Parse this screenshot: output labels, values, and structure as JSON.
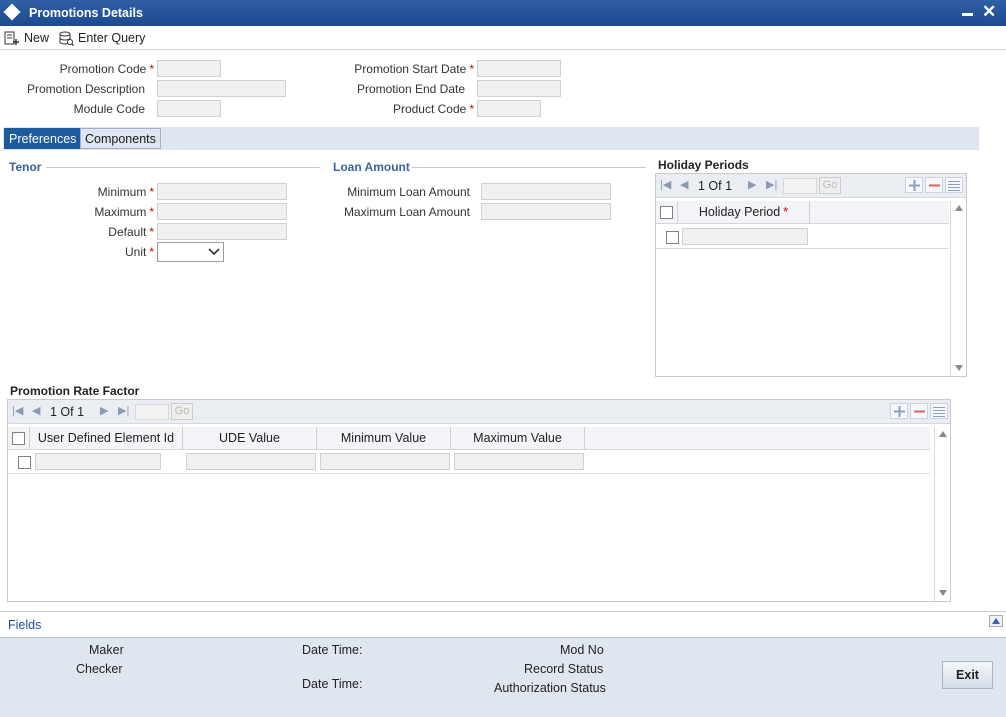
{
  "window": {
    "title": "Promotions Details"
  },
  "toolbar": {
    "new_label": "New",
    "enter_query_label": "Enter Query"
  },
  "header_fields": {
    "promotion_code": {
      "label": "Promotion Code",
      "value": ""
    },
    "promotion_description": {
      "label": "Promotion Description",
      "value": ""
    },
    "module_code": {
      "label": "Module Code",
      "value": ""
    },
    "promotion_start_date": {
      "label": "Promotion Start Date",
      "value": ""
    },
    "promotion_end_date": {
      "label": "Promotion End Date",
      "value": ""
    },
    "product_code": {
      "label": "Product Code",
      "value": ""
    }
  },
  "required_marker": "*",
  "tabs": [
    {
      "label": "Preferences",
      "active": true
    },
    {
      "label": "Components",
      "active": false
    }
  ],
  "tenor": {
    "heading": "Tenor",
    "minimum_label": "Minimum",
    "maximum_label": "Maximum",
    "default_label": "Default",
    "unit_label": "Unit",
    "unit_value": ""
  },
  "loan_amount": {
    "heading": "Loan Amount",
    "minimum_label": "Minimum Loan Amount",
    "maximum_label": "Maximum Loan Amount"
  },
  "holiday_periods": {
    "heading": "Holiday Periods",
    "page_text": "1 Of 1",
    "go_label": "Go",
    "columns": [
      "Holiday Period"
    ]
  },
  "promotion_rate_factor": {
    "heading": "Promotion Rate Factor",
    "page_text": "1 Of 1",
    "go_label": "Go",
    "columns": [
      "User Defined Element Id",
      "UDE Value",
      "Minimum Value",
      "Maximum Value"
    ]
  },
  "fields_link": "Fields",
  "footer": {
    "maker": "Maker",
    "checker": "Checker",
    "date_time_1": "Date Time:",
    "date_time_2": "Date Time:",
    "mod_no": "Mod No",
    "record_status": "Record Status",
    "authorization_status": "Authorization Status",
    "exit_label": "Exit"
  },
  "colors": {
    "title_bar": "#2f5fa5",
    "active_tab": "#1e5aa0",
    "section_heading": "#3a62a0",
    "required": "#cc0000",
    "footer_bg": "#dfe6ef"
  }
}
